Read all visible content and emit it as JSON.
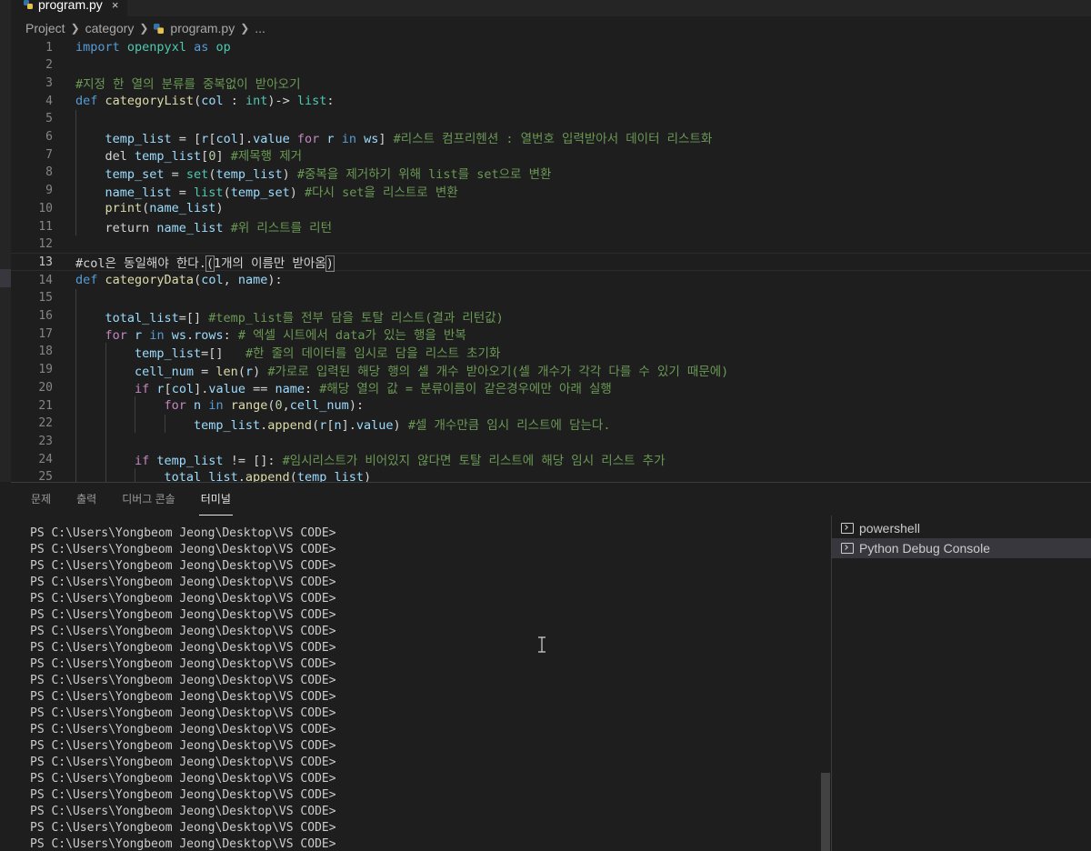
{
  "tab": {
    "filename": "program.py",
    "close_glyph": "×"
  },
  "breadcrumb": [
    "Project",
    "category",
    "program.py",
    "..."
  ],
  "editor": {
    "current_line": 13,
    "lines": [
      {
        "n": "1",
        "indent": 0,
        "tokens": [
          [
            "kw",
            "import"
          ],
          [
            "pl",
            " "
          ],
          [
            "ty",
            "openpyxl"
          ],
          [
            "pl",
            " "
          ],
          [
            "kw",
            "as"
          ],
          [
            "pl",
            " "
          ],
          [
            "ty",
            "op"
          ]
        ]
      },
      {
        "n": "2",
        "indent": 0,
        "tokens": []
      },
      {
        "n": "3",
        "indent": 0,
        "tokens": [
          [
            "cm",
            "#지정 한 열의 분류를 중복없이 받아오기"
          ]
        ]
      },
      {
        "n": "4",
        "indent": 0,
        "tokens": [
          [
            "kw",
            "def"
          ],
          [
            "pl",
            " "
          ],
          [
            "fn",
            "categoryList"
          ],
          [
            "pl",
            "("
          ],
          [
            "var",
            "col"
          ],
          [
            "pl",
            " : "
          ],
          [
            "ty",
            "int"
          ],
          [
            "pl",
            ")-> "
          ],
          [
            "ty",
            "list"
          ],
          [
            "pl",
            ":"
          ]
        ]
      },
      {
        "n": "5",
        "indent": 1,
        "tokens": []
      },
      {
        "n": "6",
        "indent": 1,
        "tokens": [
          [
            "var",
            "temp_list"
          ],
          [
            "pl",
            " = ["
          ],
          [
            "var",
            "r"
          ],
          [
            "pl",
            "["
          ],
          [
            "var",
            "col"
          ],
          [
            "pl",
            "]."
          ],
          [
            "var",
            "value"
          ],
          [
            "pl",
            " "
          ],
          [
            "ctl",
            "for"
          ],
          [
            "pl",
            " "
          ],
          [
            "var",
            "r"
          ],
          [
            "pl",
            " "
          ],
          [
            "kw",
            "in"
          ],
          [
            "pl",
            " "
          ],
          [
            "var",
            "ws"
          ],
          [
            "pl",
            "] "
          ],
          [
            "cm",
            "#리스트 컴프리헨션 : 열번호 입력받아서 데이터 리스트화"
          ]
        ]
      },
      {
        "n": "7",
        "indent": 1,
        "tokens": [
          [
            "pl",
            "del "
          ],
          [
            "var",
            "temp_list"
          ],
          [
            "pl",
            "["
          ],
          [
            "num",
            "0"
          ],
          [
            "pl",
            "] "
          ],
          [
            "cm",
            "#제목행 제거"
          ]
        ]
      },
      {
        "n": "8",
        "indent": 1,
        "tokens": [
          [
            "var",
            "temp_set"
          ],
          [
            "pl",
            " = "
          ],
          [
            "ty",
            "set"
          ],
          [
            "pl",
            "("
          ],
          [
            "var",
            "temp_list"
          ],
          [
            "pl",
            ") "
          ],
          [
            "cm",
            "#중복을 제거하기 위해 list를 set으로 변환"
          ]
        ]
      },
      {
        "n": "9",
        "indent": 1,
        "tokens": [
          [
            "var",
            "name_list"
          ],
          [
            "pl",
            " = "
          ],
          [
            "ty",
            "list"
          ],
          [
            "pl",
            "("
          ],
          [
            "var",
            "temp_set"
          ],
          [
            "pl",
            ") "
          ],
          [
            "cm",
            "#다시 set을 리스트로 변환"
          ]
        ]
      },
      {
        "n": "10",
        "indent": 1,
        "tokens": [
          [
            "fn",
            "print"
          ],
          [
            "pl",
            "("
          ],
          [
            "var",
            "name_list"
          ],
          [
            "pl",
            ")"
          ]
        ]
      },
      {
        "n": "11",
        "indent": 1,
        "tokens": [
          [
            "pl",
            "return "
          ],
          [
            "var",
            "name_list"
          ],
          [
            "pl",
            " "
          ],
          [
            "cm",
            "#위 리스트를 리턴"
          ]
        ]
      },
      {
        "n": "12",
        "indent": 0,
        "tokens": []
      },
      {
        "n": "13",
        "indent": 0,
        "tokens": [
          [
            "pl",
            "#col은 동일해야 한다."
          ],
          [
            "pl",
            "("
          ],
          [
            "pl",
            "1개의 이름만 받아옴"
          ],
          [
            "pl",
            ")"
          ]
        ]
      },
      {
        "n": "14",
        "indent": 0,
        "tokens": [
          [
            "kw",
            "def"
          ],
          [
            "pl",
            " "
          ],
          [
            "fn",
            "categoryData"
          ],
          [
            "pl",
            "("
          ],
          [
            "var",
            "col"
          ],
          [
            "pl",
            ", "
          ],
          [
            "var",
            "name"
          ],
          [
            "pl",
            "):"
          ]
        ]
      },
      {
        "n": "15",
        "indent": 1,
        "tokens": []
      },
      {
        "n": "16",
        "indent": 1,
        "tokens": [
          [
            "var",
            "total_list"
          ],
          [
            "pl",
            "=[] "
          ],
          [
            "cm",
            "#temp_list를 전부 담을 토탈 리스트(결과 리턴값)"
          ]
        ]
      },
      {
        "n": "17",
        "indent": 1,
        "tokens": [
          [
            "ctl",
            "for"
          ],
          [
            "pl",
            " "
          ],
          [
            "var",
            "r"
          ],
          [
            "pl",
            " "
          ],
          [
            "kw",
            "in"
          ],
          [
            "pl",
            " "
          ],
          [
            "var",
            "ws"
          ],
          [
            "pl",
            "."
          ],
          [
            "var",
            "rows"
          ],
          [
            "pl",
            ": "
          ],
          [
            "cm",
            "# 엑셀 시트에서 data가 있는 행을 반복"
          ]
        ]
      },
      {
        "n": "18",
        "indent": 2,
        "tokens": [
          [
            "var",
            "temp_list"
          ],
          [
            "pl",
            "=[]   "
          ],
          [
            "cm",
            "#한 줄의 데이터를 임시로 담을 리스트 초기화"
          ]
        ]
      },
      {
        "n": "19",
        "indent": 2,
        "tokens": [
          [
            "var",
            "cell_num"
          ],
          [
            "pl",
            " = "
          ],
          [
            "fn",
            "len"
          ],
          [
            "pl",
            "("
          ],
          [
            "var",
            "r"
          ],
          [
            "pl",
            ") "
          ],
          [
            "cm",
            "#가로로 입력된 해당 행의 셀 개수 받아오기(셀 개수가 각각 다를 수 있기 때문에)"
          ]
        ]
      },
      {
        "n": "20",
        "indent": 2,
        "tokens": [
          [
            "ctl",
            "if"
          ],
          [
            "pl",
            " "
          ],
          [
            "var",
            "r"
          ],
          [
            "pl",
            "["
          ],
          [
            "var",
            "col"
          ],
          [
            "pl",
            "]."
          ],
          [
            "var",
            "value"
          ],
          [
            "pl",
            " == "
          ],
          [
            "var",
            "name"
          ],
          [
            "pl",
            ": "
          ],
          [
            "cm",
            "#해당 열의 값 = 분류이름이 같은경우에만 아래 실행"
          ]
        ]
      },
      {
        "n": "21",
        "indent": 3,
        "tokens": [
          [
            "ctl",
            "for"
          ],
          [
            "pl",
            " "
          ],
          [
            "var",
            "n"
          ],
          [
            "pl",
            " "
          ],
          [
            "kw",
            "in"
          ],
          [
            "pl",
            " "
          ],
          [
            "fn",
            "range"
          ],
          [
            "pl",
            "("
          ],
          [
            "num",
            "0"
          ],
          [
            "pl",
            ","
          ],
          [
            "var",
            "cell_num"
          ],
          [
            "pl",
            "):"
          ]
        ]
      },
      {
        "n": "22",
        "indent": 4,
        "tokens": [
          [
            "var",
            "temp_list"
          ],
          [
            "pl",
            "."
          ],
          [
            "fn",
            "append"
          ],
          [
            "pl",
            "("
          ],
          [
            "var",
            "r"
          ],
          [
            "pl",
            "["
          ],
          [
            "var",
            "n"
          ],
          [
            "pl",
            "]."
          ],
          [
            "var",
            "value"
          ],
          [
            "pl",
            ") "
          ],
          [
            "cm",
            "#셀 개수만큼 임시 리스트에 담는다."
          ]
        ]
      },
      {
        "n": "23",
        "indent": 2,
        "tokens": []
      },
      {
        "n": "24",
        "indent": 2,
        "tokens": [
          [
            "ctl",
            "if"
          ],
          [
            "pl",
            " "
          ],
          [
            "var",
            "temp_list"
          ],
          [
            "pl",
            " != []: "
          ],
          [
            "cm",
            "#임시리스트가 비어있지 않다면 토탈 리스트에 해당 임시 리스트 추가"
          ]
        ]
      },
      {
        "n": "25",
        "indent": 3,
        "tokens": [
          [
            "var",
            "total_list"
          ],
          [
            "pl",
            "."
          ],
          [
            "fn",
            "append"
          ],
          [
            "pl",
            "("
          ],
          [
            "var",
            "temp_list"
          ],
          [
            "pl",
            ")"
          ]
        ]
      }
    ]
  },
  "panel": {
    "tabs": [
      {
        "label": "문제",
        "active": false
      },
      {
        "label": "출력",
        "active": false
      },
      {
        "label": "디버그 콘솔",
        "active": false
      },
      {
        "label": "터미널",
        "active": true
      }
    ],
    "terminal_prompt": "PS C:\\Users\\Yongbeom Jeong\\Desktop\\VS CODE>",
    "terminal_line_count": 20,
    "terminals": [
      {
        "label": "powershell",
        "selected": false
      },
      {
        "label": "Python Debug Console",
        "selected": true
      }
    ]
  }
}
